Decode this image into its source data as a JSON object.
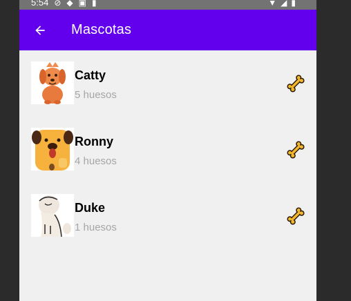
{
  "status_bar": {
    "time": "5:54"
  },
  "app_bar": {
    "title": "Mascotas",
    "back_icon": "arrow-back-icon"
  },
  "pets": [
    {
      "name": "Catty",
      "bones": "5 huesos",
      "image": "orange-dog-illustration",
      "bone_icon": "bone-icon"
    },
    {
      "name": "Ronny",
      "bones": "4 huesos",
      "image": "yellow-dog-illustration",
      "bone_icon": "bone-icon"
    },
    {
      "name": "Duke",
      "bones": "1 huesos",
      "image": "white-dog-illustration",
      "bone_icon": "bone-icon"
    }
  ],
  "colors": {
    "app_bar": "#6200ee",
    "status_bar": "#737373",
    "background": "#f0f0f0",
    "bone": "#f2b530"
  }
}
